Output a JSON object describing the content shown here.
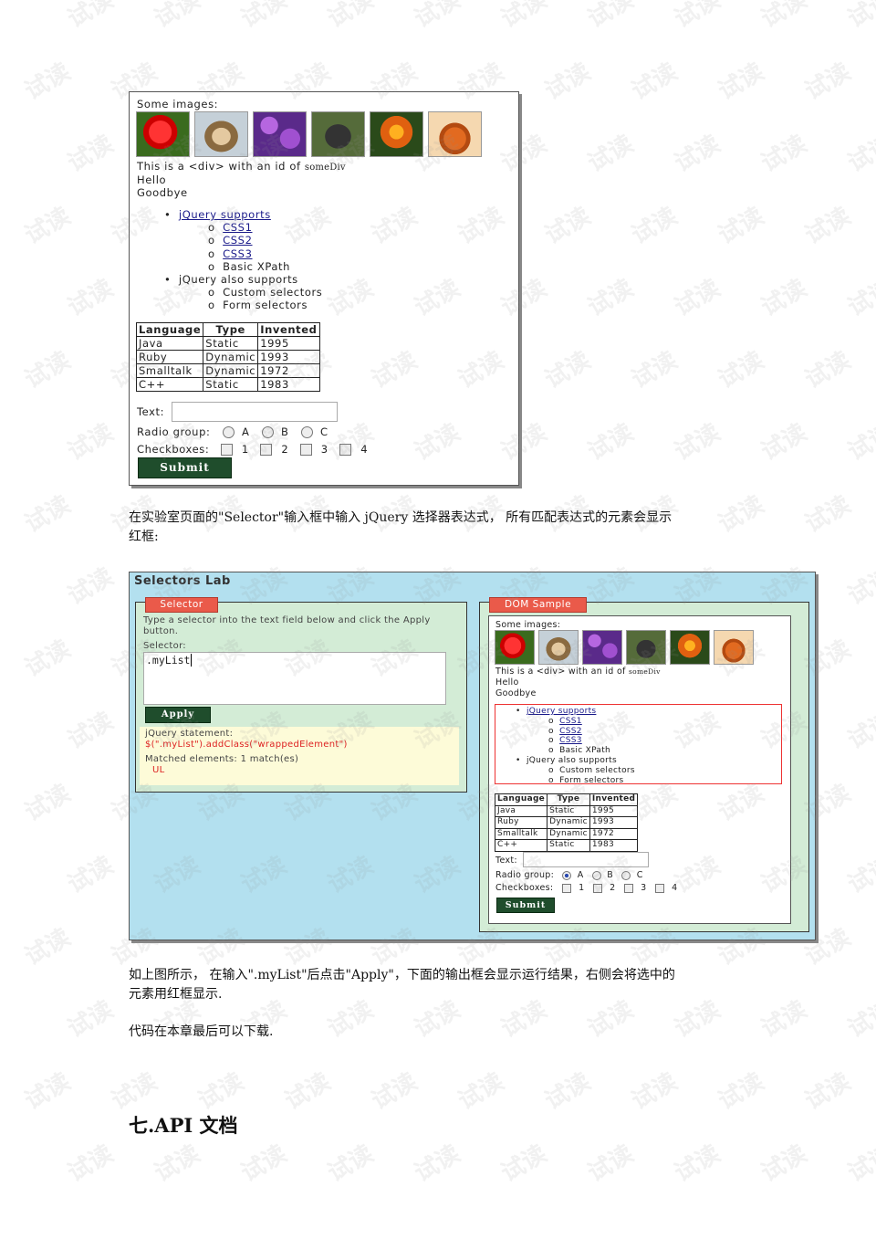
{
  "panel1": {
    "some_images": "Some images:",
    "images": [
      "flower-icon",
      "dog-icon",
      "flower-icon",
      "dog-icon",
      "flower-icon",
      "teapot-icon"
    ],
    "div_line": {
      "pre": "This is a <div> with an id of ",
      "id": "someDiv"
    },
    "hello": "Hello",
    "goodbye": "Goodbye",
    "list": {
      "item1": "jQuery supports",
      "css1": "CSS1",
      "css2": "CSS2",
      "css3": "CSS3",
      "xpath": "Basic XPath",
      "item2": "jQuery also supports",
      "custom": "Custom selectors",
      "form": "Form selectors"
    },
    "table": {
      "headers": [
        "Language",
        "Type",
        "Invented"
      ],
      "rows": [
        [
          "Java",
          "Static",
          "1995"
        ],
        [
          "Ruby",
          "Dynamic",
          "1993"
        ],
        [
          "Smalltalk",
          "Dynamic",
          "1972"
        ],
        [
          "C++",
          "Static",
          "1983"
        ]
      ]
    },
    "text_label": "Text:",
    "radio_label": "Radio group:",
    "radio_options": [
      "A",
      "B",
      "C"
    ],
    "checkbox_label": "Checkboxes:",
    "checkbox_options": [
      "1",
      "2",
      "3",
      "4"
    ],
    "submit": "Submit"
  },
  "para1": {
    "line1": "在实验室页面的\"Selector\"输入框中输入 jQuery 选择器表达式， 所有匹配表达式的元素会显示",
    "line2": "红框:"
  },
  "lab": {
    "title": "Selectors Lab",
    "selector_legend": "Selector",
    "instructions": "Type a selector into the text field below and click the Apply button.",
    "selector_label": "Selector:",
    "selector_value": ".myList",
    "apply": "Apply",
    "statement_label": "jQuery statement:",
    "statement": "$(\".myList\").addClass(\"wrappedElement\")",
    "matched": "Matched elements: 1 match(es)",
    "matched_tag": "UL",
    "dom_legend": "DOM Sample",
    "radio_selected": "A"
  },
  "para2": {
    "line1": "如上图所示， 在输入\".myList\"后点击\"Apply\"，下面的输出框会显示运行结果，右侧会将选中的",
    "line2": "元素用红框显示."
  },
  "para3": "代码在本章最后可以下载.",
  "heading": "七.API 文档",
  "watermark": "试读"
}
